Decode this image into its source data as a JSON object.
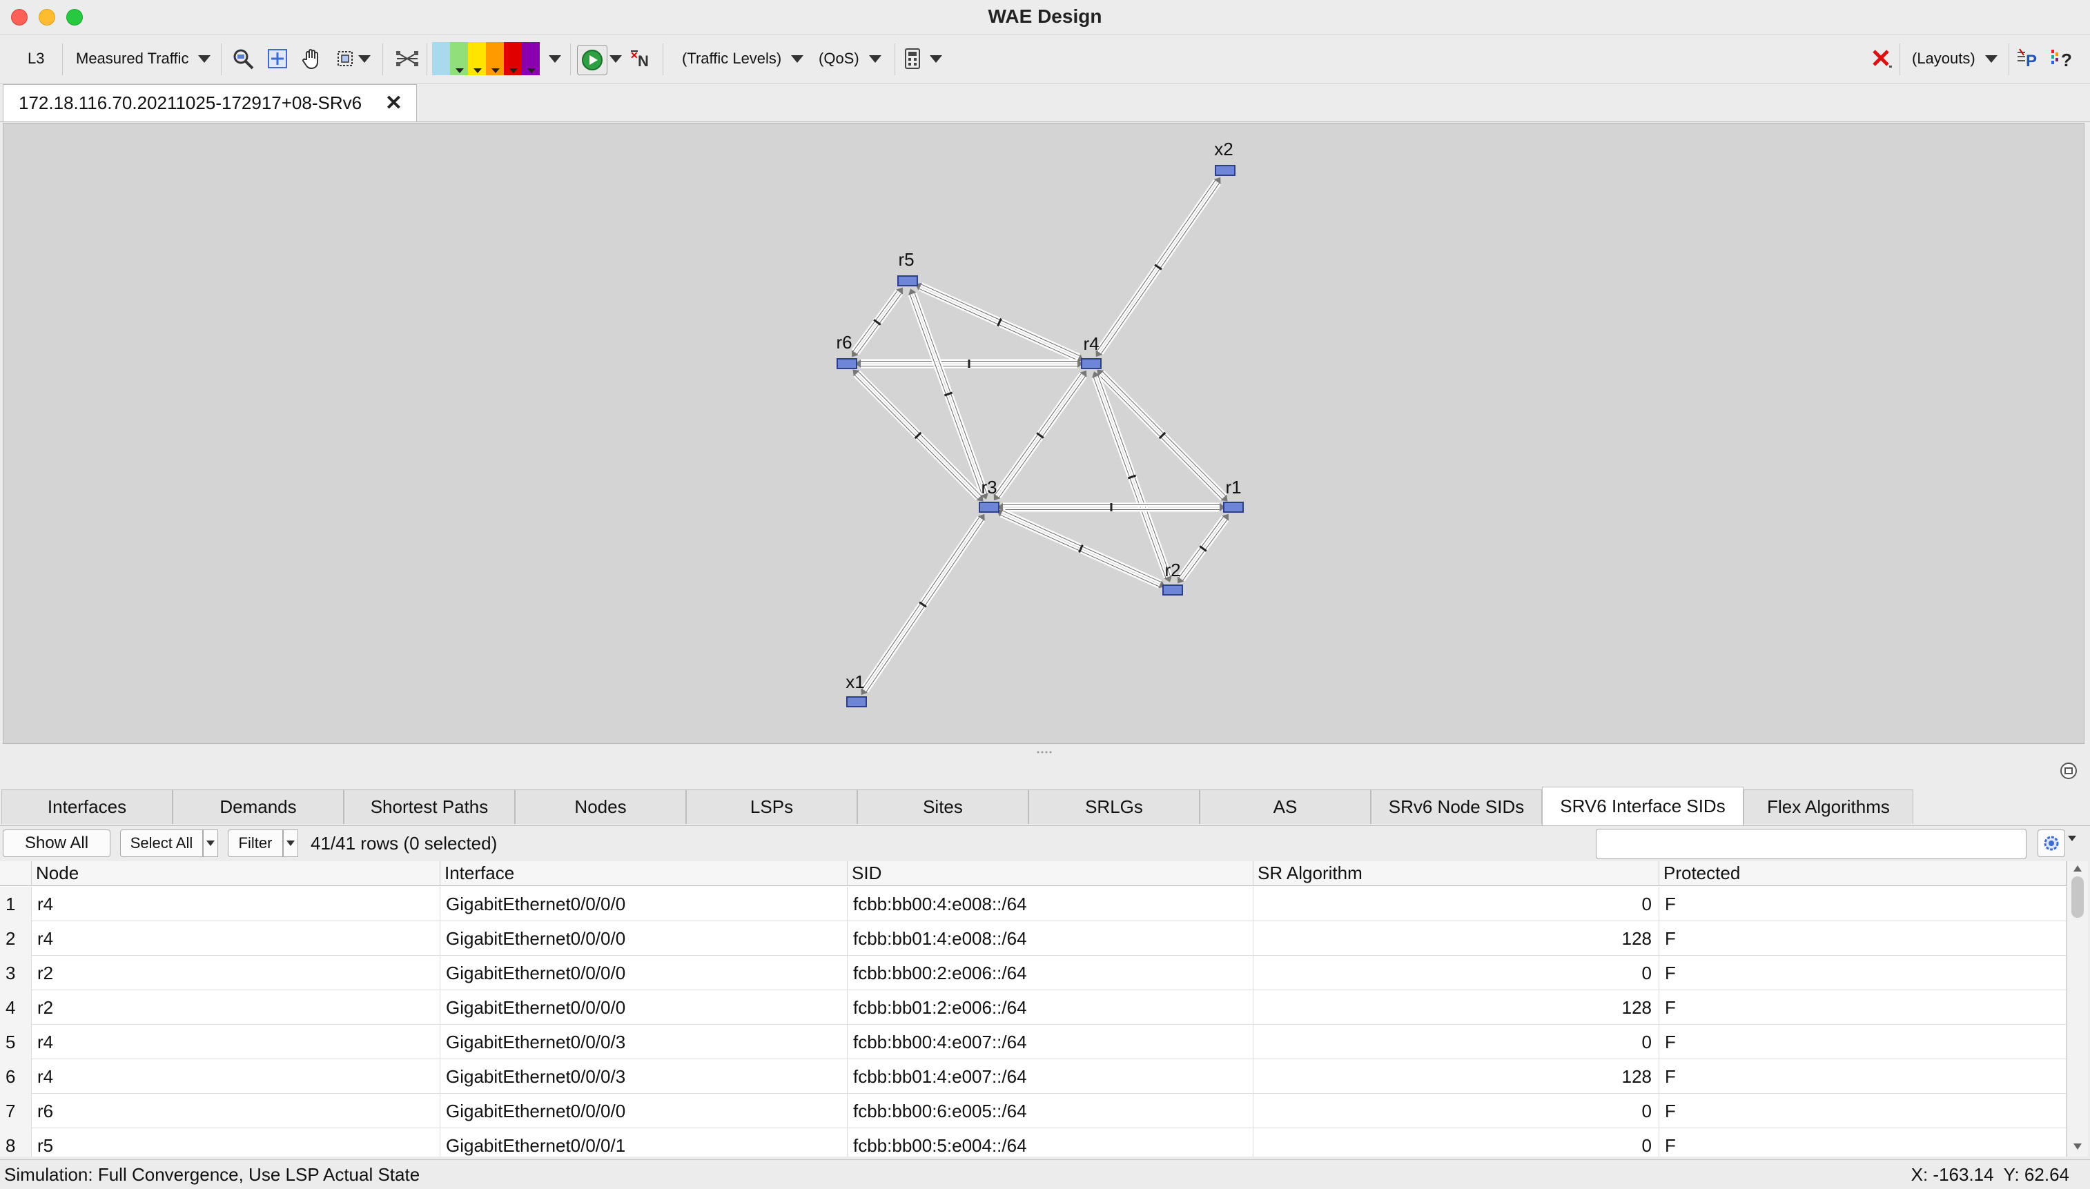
{
  "window": {
    "title": "WAE Design"
  },
  "toolbar": {
    "layer_label": "L3",
    "traffic_dropdown": "Measured Traffic",
    "traffic_levels_dropdown": "(Traffic Levels)",
    "qos_dropdown": "(QoS)",
    "layouts_dropdown": "(Layouts)",
    "colors": [
      "#a9d9ec",
      "#8fe07b",
      "#ffe400",
      "#ff9a00",
      "#e00000",
      "#8a00b0"
    ]
  },
  "document_tab": {
    "label": "172.18.116.70.20211025-172917+08-SRv6"
  },
  "topology": {
    "nodes": [
      {
        "id": "x2",
        "label": "x2"
      },
      {
        "id": "r5",
        "label": "r5"
      },
      {
        "id": "r6",
        "label": "r6"
      },
      {
        "id": "r4",
        "label": "r4"
      },
      {
        "id": "r3",
        "label": "r3"
      },
      {
        "id": "r1",
        "label": "r1"
      },
      {
        "id": "r2",
        "label": "r2"
      },
      {
        "id": "x1",
        "label": "x1"
      }
    ],
    "links": [
      [
        "r4",
        "x2"
      ],
      [
        "r5",
        "r6"
      ],
      [
        "r5",
        "r4"
      ],
      [
        "r6",
        "r4"
      ],
      [
        "r5",
        "r3"
      ],
      [
        "r6",
        "r3"
      ],
      [
        "r3",
        "r4"
      ],
      [
        "r4",
        "r1"
      ],
      [
        "r4",
        "r2"
      ],
      [
        "r3",
        "r1"
      ],
      [
        "r3",
        "r2"
      ],
      [
        "r1",
        "r2"
      ],
      [
        "x1",
        "r3"
      ]
    ]
  },
  "bottom_tabs": [
    {
      "label": "Interfaces"
    },
    {
      "label": "Demands"
    },
    {
      "label": "Shortest Paths"
    },
    {
      "label": "Nodes"
    },
    {
      "label": "LSPs"
    },
    {
      "label": "Sites"
    },
    {
      "label": "SRLGs"
    },
    {
      "label": "AS"
    },
    {
      "label": "SRv6 Node SIDs"
    },
    {
      "label": "SRV6 Interface SIDs",
      "active": true
    },
    {
      "label": "Flex Algorithms"
    }
  ],
  "filter_bar": {
    "show_all": "Show All",
    "select_all": "Select All",
    "filter": "Filter",
    "row_count": "41/41 rows (0 selected)",
    "search_value": ""
  },
  "table": {
    "columns": [
      "Node",
      "Interface",
      "SID",
      "SR Algorithm",
      "Protected"
    ],
    "rows": [
      {
        "n": "1",
        "node": "r4",
        "interface": "GigabitEthernet0/0/0/0",
        "sid": "fcbb:bb00:4:e008::/64",
        "algo": "0",
        "protected": "F"
      },
      {
        "n": "2",
        "node": "r4",
        "interface": "GigabitEthernet0/0/0/0",
        "sid": "fcbb:bb01:4:e008::/64",
        "algo": "128",
        "protected": "F"
      },
      {
        "n": "3",
        "node": "r2",
        "interface": "GigabitEthernet0/0/0/0",
        "sid": "fcbb:bb00:2:e006::/64",
        "algo": "0",
        "protected": "F"
      },
      {
        "n": "4",
        "node": "r2",
        "interface": "GigabitEthernet0/0/0/0",
        "sid": "fcbb:bb01:2:e006::/64",
        "algo": "128",
        "protected": "F"
      },
      {
        "n": "5",
        "node": "r4",
        "interface": "GigabitEthernet0/0/0/3",
        "sid": "fcbb:bb00:4:e007::/64",
        "algo": "0",
        "protected": "F"
      },
      {
        "n": "6",
        "node": "r4",
        "interface": "GigabitEthernet0/0/0/3",
        "sid": "fcbb:bb01:4:e007::/64",
        "algo": "128",
        "protected": "F"
      },
      {
        "n": "7",
        "node": "r6",
        "interface": "GigabitEthernet0/0/0/0",
        "sid": "fcbb:bb00:6:e005::/64",
        "algo": "0",
        "protected": "F"
      },
      {
        "n": "8",
        "node": "r5",
        "interface": "GigabitEthernet0/0/0/1",
        "sid": "fcbb:bb00:5:e004::/64",
        "algo": "0",
        "protected": "F"
      }
    ]
  },
  "status_bar": {
    "simulation": "Simulation: Full Convergence, Use LSP Actual State",
    "coords": "X: -163.14  Y: 62.64"
  }
}
